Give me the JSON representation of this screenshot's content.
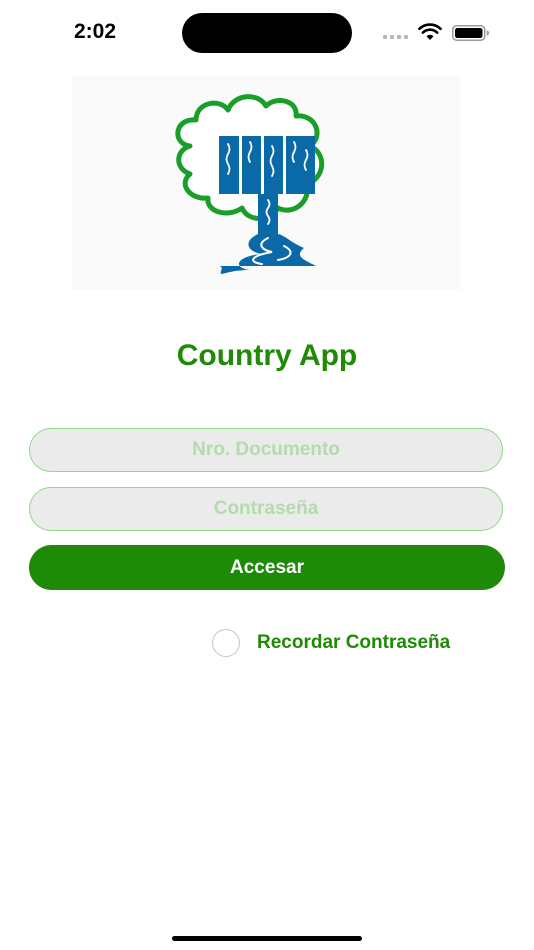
{
  "status_bar": {
    "time": "2:02",
    "icons": [
      "cellular-signal-icon",
      "wifi-icon",
      "battery-icon"
    ]
  },
  "logo": {
    "icon": "tree-waterfall-logo",
    "colors": {
      "foliage": "#1a9e2a",
      "water": "#0a6aa8"
    }
  },
  "title": "Country App",
  "form": {
    "document_placeholder": "Nro. Documento",
    "document_value": "",
    "password_placeholder": "Contraseña",
    "password_value": "",
    "submit_label": "Accesar",
    "remember_label": "Recordar Contraseña",
    "remember_checked": false
  },
  "colors": {
    "accent": "#1f8a07",
    "field_background": "#ebebeb",
    "field_border": "#8fd987",
    "placeholder": "#b4dbae"
  }
}
